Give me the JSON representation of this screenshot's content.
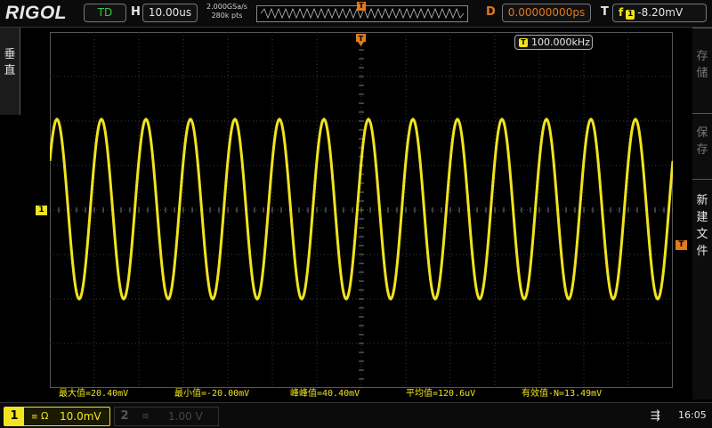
{
  "header": {
    "brand": "RIGOL",
    "run_status": "TD",
    "horizontal_label": "H",
    "timebase": "10.00us",
    "sample_rate": "2.000GSa/s",
    "memory_depth": "280k pts",
    "overview_marker": "T",
    "delay_label": "D",
    "delay_value": "0.00000000ps",
    "trigger_label": "T",
    "trigger_edge": "f",
    "trigger_source": "1",
    "trigger_level": "-8.20mV"
  },
  "left_menu": {
    "label": "垂直"
  },
  "right_menu": [
    {
      "label": "存储"
    },
    {
      "label": "保存"
    },
    {
      "label": "新建文件"
    }
  ],
  "frequency_counter": {
    "icon": "T",
    "value": "100.000kHz"
  },
  "measurements": [
    {
      "text": "最大值=20.40mV"
    },
    {
      "text": "最小值=-20.00mV"
    },
    {
      "text": "峰峰值=40.40mV"
    },
    {
      "text": "平均值=120.6uV"
    },
    {
      "text": "有效值-N=13.49mV"
    }
  ],
  "markers": {
    "ch1": "1",
    "trigger": "T",
    "position": "T"
  },
  "channels": {
    "ch1": {
      "number": "1",
      "coupling": "Ω",
      "scale": "10.0mV"
    },
    "ch2": {
      "number": "2",
      "coupling": "",
      "scale": "1.00 V"
    }
  },
  "status": {
    "usb_icon": "usb-icon",
    "time": "16:05"
  },
  "colors": {
    "ch1": "#f1e31f",
    "trigger": "#e07a1e",
    "td": "#2ecc40"
  },
  "waveform": {
    "frequency_khz": 100,
    "timebase_us_per_div": 10,
    "vertical_mv_per_div": 10,
    "amplitude_mv": 20.2
  }
}
